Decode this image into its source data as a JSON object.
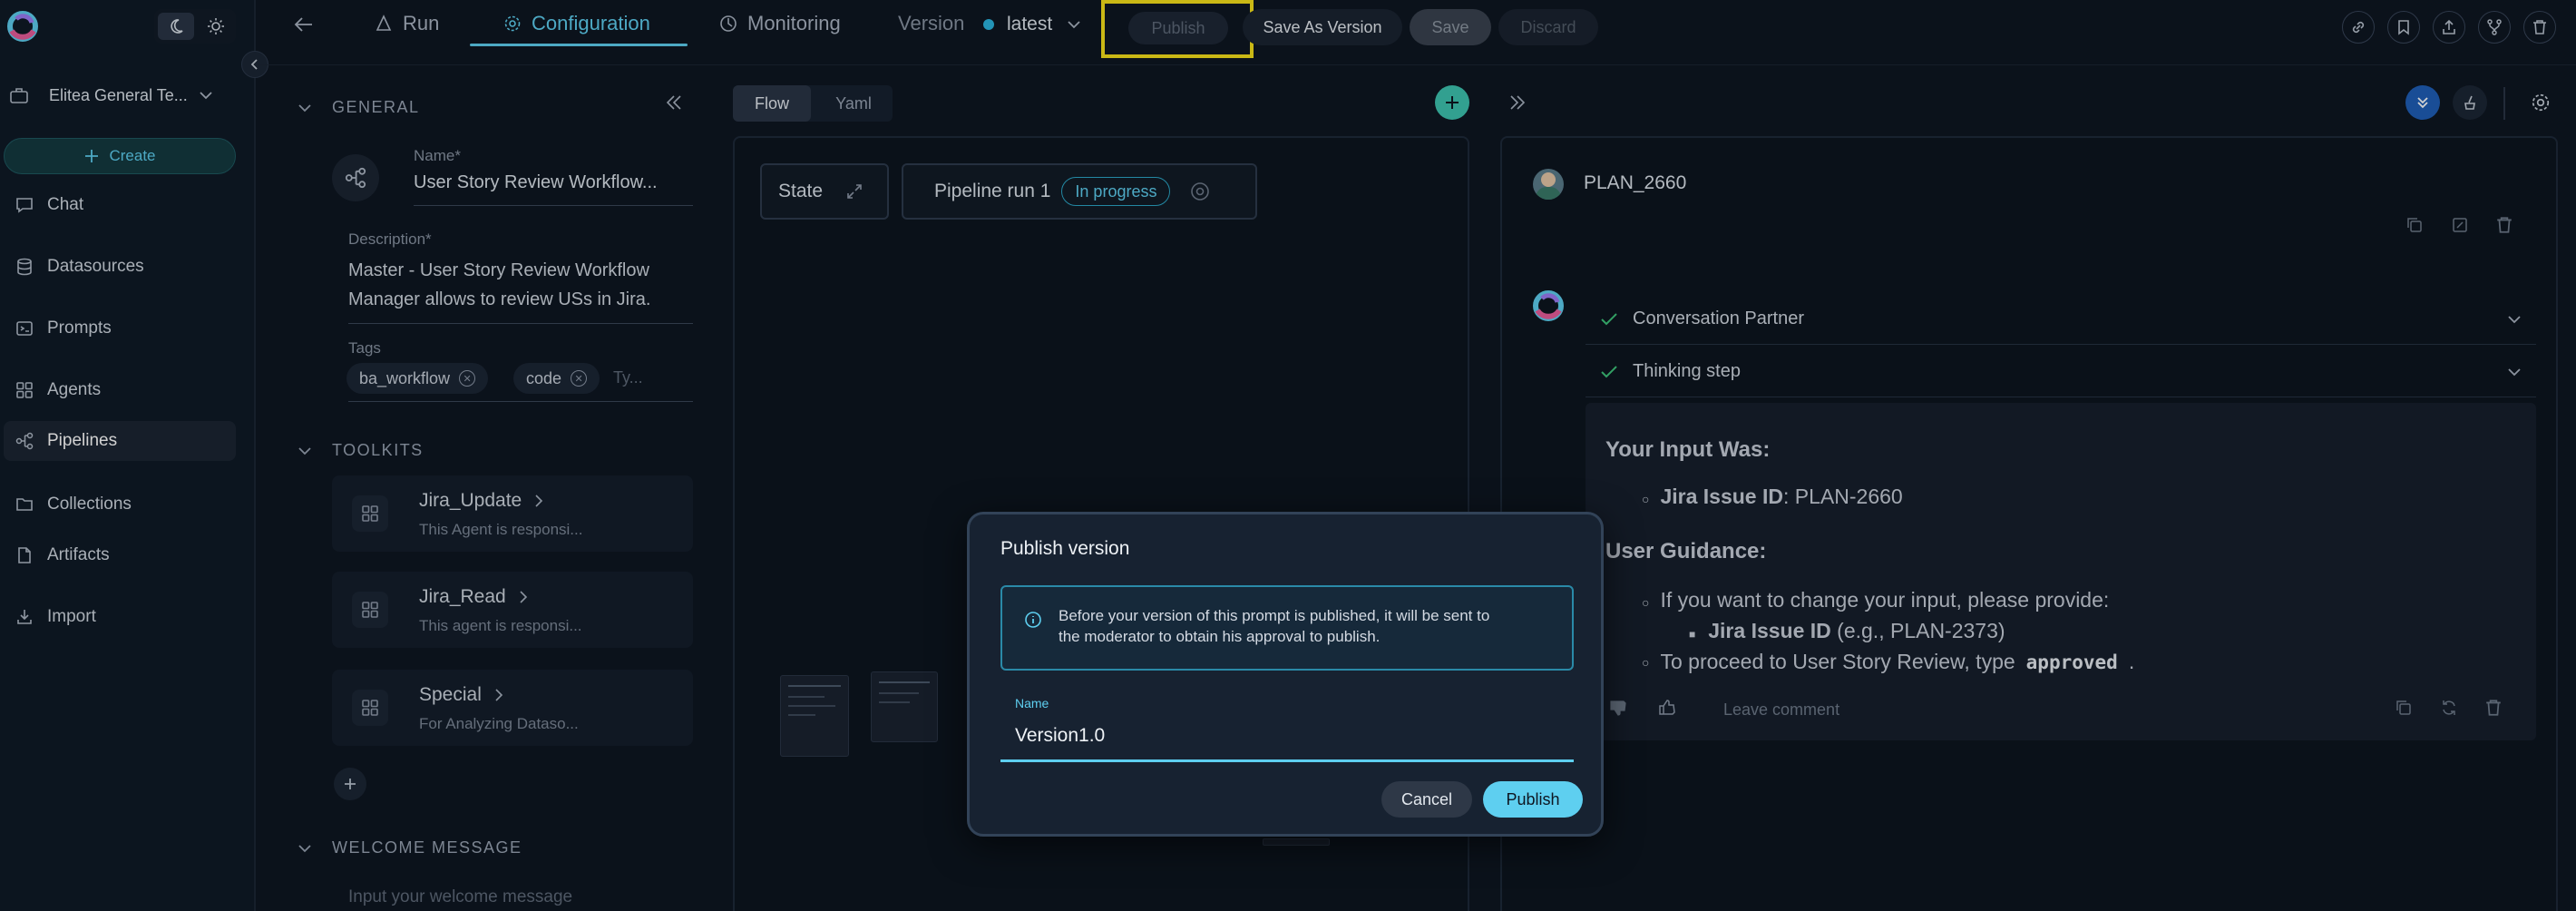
{
  "sidebar": {
    "project": "Elitea General Te...",
    "create_label": "Create",
    "items": [
      {
        "label": "Chat",
        "icon": "chat-icon"
      },
      {
        "label": "Datasources",
        "icon": "database-icon"
      },
      {
        "label": "Prompts",
        "icon": "prompt-icon"
      },
      {
        "label": "Agents",
        "icon": "grid-icon"
      },
      {
        "label": "Pipelines",
        "icon": "pipeline-icon"
      },
      {
        "label": "Collections",
        "icon": "folder-icon"
      },
      {
        "label": "Artifacts",
        "icon": "file-icon"
      },
      {
        "label": "Import",
        "icon": "import-icon"
      }
    ],
    "active_item": "Pipelines"
  },
  "topbar": {
    "tabs": [
      {
        "label": "Run",
        "icon": "run-icon"
      },
      {
        "label": "Configuration",
        "icon": "gear-icon"
      },
      {
        "label": "Monitoring",
        "icon": "monitoring-icon"
      }
    ],
    "active_tab": "Configuration",
    "version_label": "Version",
    "version_value": "latest",
    "publish_label": "Publish",
    "save_as_version_label": "Save As Version",
    "save_label": "Save",
    "discard_label": "Discard",
    "accent": "#5ecff0",
    "highlight_color": "#f7e11a"
  },
  "general": {
    "section_title": "GENERAL",
    "name_label": "Name*",
    "name_value": "User Story Review Workflow...",
    "description_label": "Description*",
    "description_line1": "Master - User Story Review Workflow",
    "description_line2": "Manager allows to review USs in Jira.",
    "tags_label": "Tags",
    "tags": [
      "ba_workflow",
      "code"
    ],
    "tags_placeholder": "Ty..."
  },
  "toolkits": {
    "section_title": "TOOLKITS",
    "items": [
      {
        "name": "Jira_Update",
        "desc": "This Agent is responsi..."
      },
      {
        "name": "Jira_Read",
        "desc": "This agent is responsi..."
      },
      {
        "name": "Special",
        "desc": "For Analyzing Dataso..."
      }
    ]
  },
  "welcome": {
    "section_title": "WELCOME MESSAGE",
    "placeholder": "Input your welcome message"
  },
  "flow": {
    "tabs": [
      "Flow",
      "Yaml"
    ],
    "active_tab": "Flow",
    "state_label": "State",
    "pipeline_run_label": "Pipeline run 1",
    "status_badge": "In progress"
  },
  "chat": {
    "user_name": "PLAN_2660",
    "steps": [
      "Conversation Partner",
      "Thinking step"
    ],
    "input_heading": "Your Input Was:",
    "input_item_key": "Jira Issue ID",
    "input_item_value": ": PLAN-2660",
    "guidance_heading": "User Guidance:",
    "guidance_item1": "If you want to change your input, please provide:",
    "guidance_sub_key": "Jira Issue ID",
    "guidance_sub_value": " (e.g., PLAN-2373)",
    "guidance_item2_pre": "To proceed to User Story Review, type",
    "guidance_item2_code": "approved",
    "guidance_item2_post": ".",
    "leave_comment": "Leave comment"
  },
  "modal": {
    "title": "Publish version",
    "info_line1": "Before your version of this prompt is published, it will be sent to",
    "info_line2": "the moderator to obtain his approval to publish.",
    "name_label": "Name",
    "name_value": "Version1.0",
    "cancel_label": "Cancel",
    "publish_label": "Publish"
  }
}
